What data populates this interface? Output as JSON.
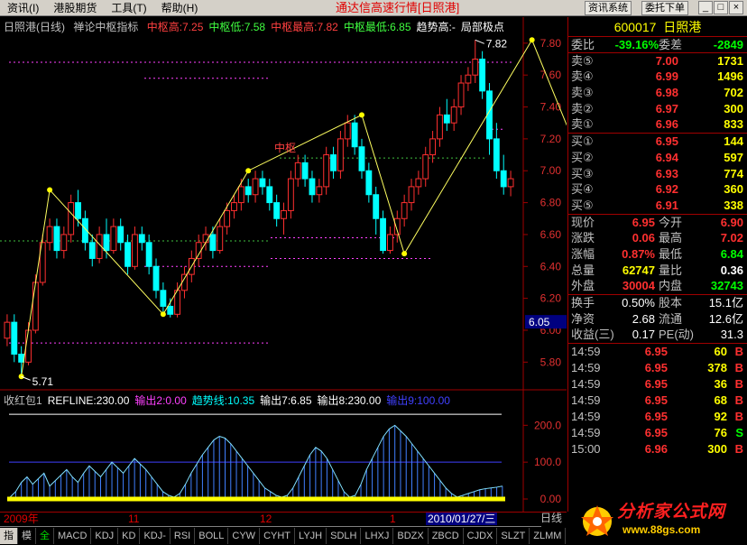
{
  "menu": {
    "items": [
      "资讯(I)",
      "港股期货",
      "工具(T)",
      "帮助(H)"
    ],
    "title": "通达信高速行情[日照港]",
    "btn_news": "资讯系统",
    "btn_entrust": "委托下单"
  },
  "main_legend": {
    "name": "日照港(日线)",
    "indicator": "禅论中枢指标",
    "items": [
      {
        "label": "中枢高:7.25",
        "color": "#ff4040"
      },
      {
        "label": "中枢低:7.58",
        "color": "#40ff40"
      },
      {
        "label": "中枢最高:7.82",
        "color": "#ff4040"
      },
      {
        "label": "中枢最低:6.85",
        "color": "#40ff40"
      },
      {
        "label": "趋势高:-",
        "color": "#ffffff"
      },
      {
        "label": "局部极点",
        "color": "#ffffff"
      }
    ]
  },
  "sub_legend": {
    "items": [
      {
        "label": "收红包1",
        "color": "#c0c0c0"
      },
      {
        "label": "REFLINE:230.00",
        "color": "#ffffff"
      },
      {
        "label": "输出2:0.00",
        "color": "#ff40ff"
      },
      {
        "label": "趋势线:10.35",
        "color": "#00ffff"
      },
      {
        "label": "输出7:6.85",
        "color": "#ffffff"
      },
      {
        "label": "输出8:230.00",
        "color": "#ffffff"
      },
      {
        "label": "输出9:100.00",
        "color": "#4040ff"
      }
    ]
  },
  "price_axis": {
    "ticks": [
      "7.80",
      "7.60",
      "7.40",
      "7.20",
      "7.00",
      "6.80",
      "6.60",
      "6.40",
      "6.20",
      "6.00",
      "5.80"
    ],
    "cursor": "6.05"
  },
  "sub_axis": {
    "ticks": [
      "200.0",
      "100.0",
      "0.00"
    ]
  },
  "annotations": {
    "high_label": "7.82",
    "low_label": "5.71",
    "zhong_shu_label": "中枢"
  },
  "dates": {
    "start": "2009年",
    "m11": "11",
    "m12": "12",
    "m1": "1",
    "cursor": "2010/01/27/三",
    "period": "日线"
  },
  "tabs": [
    "指标",
    "模板",
    "全部",
    "MACD",
    "KDJ",
    "KD",
    "KDJ-TDX",
    "RSI",
    "BOLL",
    "CYW",
    "CYHT",
    "LYJH",
    "SDLH",
    "LHXJ",
    "BDZX",
    "ZBCD",
    "CJDX",
    "SLZT",
    "ZLMM"
  ],
  "panel": {
    "code": "600017",
    "name": "日照港",
    "weibi_label": "委比",
    "weibi": "-39.16%",
    "weicha_label": "委差",
    "weicha": "-2849",
    "sell": [
      {
        "label": "卖⑤",
        "price": "7.00",
        "vol": "1731"
      },
      {
        "label": "卖④",
        "price": "6.99",
        "vol": "1496"
      },
      {
        "label": "卖③",
        "price": "6.98",
        "vol": "702"
      },
      {
        "label": "卖②",
        "price": "6.97",
        "vol": "300"
      },
      {
        "label": "卖①",
        "price": "6.96",
        "vol": "833"
      }
    ],
    "buy": [
      {
        "label": "买①",
        "price": "6.95",
        "vol": "144"
      },
      {
        "label": "买②",
        "price": "6.94",
        "vol": "597"
      },
      {
        "label": "买③",
        "price": "6.93",
        "vol": "774"
      },
      {
        "label": "买④",
        "price": "6.92",
        "vol": "360"
      },
      {
        "label": "买⑤",
        "price": "6.91",
        "vol": "338"
      }
    ],
    "stats": [
      {
        "l1": "现价",
        "v1": "6.95",
        "c1": "red",
        "l2": "今开",
        "v2": "6.90",
        "c2": "red"
      },
      {
        "l1": "涨跌",
        "v1": "0.06",
        "c1": "red",
        "l2": "最高",
        "v2": "7.02",
        "c2": "red"
      },
      {
        "l1": "涨幅",
        "v1": "0.87%",
        "c1": "red",
        "l2": "最低",
        "v2": "6.84",
        "c2": "green"
      },
      {
        "l1": "总量",
        "v1": "62747",
        "c1": "yellow",
        "l2": "量比",
        "v2": "0.36",
        "c2": "white"
      },
      {
        "l1": "外盘",
        "v1": "30004",
        "c1": "red",
        "l2": "内盘",
        "v2": "32743",
        "c2": "green"
      }
    ],
    "finance": [
      {
        "l1": "换手",
        "v1": "0.50%",
        "l2": "股本",
        "v2": "15.1亿"
      },
      {
        "l1": "净资",
        "v1": "2.68",
        "l2": "流通",
        "v2": "12.6亿"
      },
      {
        "l1": "收益(三)",
        "v1": "0.17",
        "l2": "PE(动)",
        "v2": "31.3"
      }
    ],
    "trades": [
      {
        "time": "14:59",
        "price": "6.95",
        "vol": "60",
        "dir": "B",
        "dcolor": "#ff3030"
      },
      {
        "time": "14:59",
        "price": "6.95",
        "vol": "378",
        "dir": "B",
        "dcolor": "#ff3030"
      },
      {
        "time": "14:59",
        "price": "6.95",
        "vol": "36",
        "dir": "B",
        "dcolor": "#ff3030"
      },
      {
        "time": "14:59",
        "price": "6.95",
        "vol": "68",
        "dir": "B",
        "dcolor": "#ff3030"
      },
      {
        "time": "14:59",
        "price": "6.95",
        "vol": "92",
        "dir": "B",
        "dcolor": "#ff3030"
      },
      {
        "time": "14:59",
        "price": "6.95",
        "vol": "76",
        "dir": "S",
        "dcolor": "#00ff00"
      },
      {
        "time": "15:00",
        "price": "6.96",
        "vol": "300",
        "dir": "B",
        "dcolor": "#ff3030"
      }
    ]
  },
  "watermark": {
    "text": "分析家公式网",
    "url": "www.88gs.com"
  },
  "chart_data": {
    "type": "candlestick",
    "ylim": [
      5.7,
      7.85
    ],
    "candles": [
      [
        5.95,
        6.05,
        6.1,
        5.9
      ],
      [
        6.05,
        5.85,
        6.1,
        5.8
      ],
      [
        5.85,
        5.8,
        5.9,
        5.71
      ],
      [
        5.8,
        6.0,
        6.05,
        5.78
      ],
      [
        6.0,
        6.3,
        6.35,
        5.98
      ],
      [
        6.3,
        6.55,
        6.6,
        6.28
      ],
      [
        6.55,
        6.65,
        6.7,
        6.5
      ],
      [
        6.65,
        6.5,
        6.7,
        6.45
      ],
      [
        6.5,
        6.6,
        6.65,
        6.45
      ],
      [
        6.6,
        6.8,
        6.85,
        6.55
      ],
      [
        6.8,
        6.7,
        6.88,
        6.65
      ],
      [
        6.7,
        6.55,
        6.75,
        6.5
      ],
      [
        6.55,
        6.45,
        6.6,
        6.4
      ],
      [
        6.45,
        6.6,
        6.65,
        6.42
      ],
      [
        6.6,
        6.5,
        6.7,
        6.45
      ],
      [
        6.5,
        6.65,
        6.7,
        6.48
      ],
      [
        6.65,
        6.55,
        6.7,
        6.5
      ],
      [
        6.55,
        6.4,
        6.6,
        6.35
      ],
      [
        6.4,
        6.6,
        6.65,
        6.38
      ],
      [
        6.6,
        6.55,
        6.65,
        6.5
      ],
      [
        6.55,
        6.4,
        6.6,
        6.35
      ],
      [
        6.4,
        6.25,
        6.45,
        6.2
      ],
      [
        6.25,
        6.15,
        6.3,
        6.1
      ],
      [
        6.15,
        6.1,
        6.2,
        6.08
      ],
      [
        6.1,
        6.25,
        6.3,
        6.08
      ],
      [
        6.25,
        6.35,
        6.4,
        6.2
      ],
      [
        6.35,
        6.45,
        6.5,
        6.3
      ],
      [
        6.45,
        6.55,
        6.6,
        6.4
      ],
      [
        6.55,
        6.6,
        6.65,
        6.5
      ],
      [
        6.6,
        6.5,
        6.65,
        6.45
      ],
      [
        6.5,
        6.65,
        6.7,
        6.48
      ],
      [
        6.65,
        6.75,
        6.8,
        6.6
      ],
      [
        6.75,
        6.8,
        6.85,
        6.7
      ],
      [
        6.8,
        6.9,
        6.95,
        6.75
      ],
      [
        6.9,
        6.85,
        6.95,
        6.8
      ],
      [
        6.85,
        6.95,
        7.0,
        6.8
      ],
      [
        6.95,
        6.9,
        7.0,
        6.85
      ],
      [
        6.9,
        6.8,
        6.95,
        6.75
      ],
      [
        6.8,
        6.7,
        6.85,
        6.65
      ],
      [
        6.7,
        6.75,
        6.8,
        6.6
      ],
      [
        6.75,
        6.95,
        7.0,
        6.7
      ],
      [
        6.95,
        7.05,
        7.1,
        6.9
      ],
      [
        7.05,
        6.95,
        7.1,
        6.9
      ],
      [
        6.95,
        6.85,
        7.0,
        6.8
      ],
      [
        6.85,
        6.9,
        6.95,
        6.8
      ],
      [
        6.9,
        7.1,
        7.15,
        6.85
      ],
      [
        7.1,
        7.0,
        7.15,
        6.95
      ],
      [
        7.0,
        7.2,
        7.25,
        6.95
      ],
      [
        7.2,
        7.3,
        7.35,
        7.15
      ],
      [
        7.3,
        7.15,
        7.35,
        7.1
      ],
      [
        7.15,
        7.0,
        7.2,
        6.95
      ],
      [
        7.0,
        6.85,
        7.05,
        6.8
      ],
      [
        6.85,
        6.7,
        6.9,
        6.6
      ],
      [
        6.7,
        6.5,
        6.75,
        6.48
      ],
      [
        6.5,
        6.6,
        6.65,
        6.48
      ],
      [
        6.6,
        6.7,
        6.75,
        6.55
      ],
      [
        6.7,
        6.8,
        6.85,
        6.65
      ],
      [
        6.8,
        6.9,
        6.95,
        6.75
      ],
      [
        6.9,
        6.95,
        7.0,
        6.85
      ],
      [
        6.95,
        7.1,
        7.15,
        6.9
      ],
      [
        7.1,
        7.2,
        7.25,
        7.05
      ],
      [
        7.2,
        7.35,
        7.4,
        7.15
      ],
      [
        7.35,
        7.3,
        7.45,
        7.25
      ],
      [
        7.3,
        7.4,
        7.45,
        7.25
      ],
      [
        7.4,
        7.55,
        7.6,
        7.35
      ],
      [
        7.55,
        7.6,
        7.65,
        7.5
      ],
      [
        7.6,
        7.7,
        7.82,
        7.55
      ],
      [
        7.7,
        7.5,
        7.75,
        7.45
      ],
      [
        7.5,
        7.2,
        7.55,
        7.1
      ],
      [
        7.2,
        7.0,
        7.3,
        6.95
      ],
      [
        7.0,
        6.9,
        7.1,
        6.85
      ],
      [
        6.9,
        6.95,
        7.0,
        6.84
      ]
    ],
    "zigzag": [
      [
        2,
        5.71
      ],
      [
        6,
        6.88
      ],
      [
        22,
        6.1
      ],
      [
        34,
        7.0
      ],
      [
        50,
        7.35
      ],
      [
        56,
        6.48
      ],
      [
        74,
        7.82
      ],
      [
        83,
        6.84
      ]
    ],
    "oscillator": [
      5,
      20,
      45,
      60,
      40,
      55,
      70,
      35,
      50,
      65,
      80,
      60,
      45,
      70,
      90,
      75,
      60,
      80,
      100,
      85,
      70,
      90,
      110,
      95,
      80,
      60,
      40,
      20,
      10,
      5,
      15,
      40,
      70,
      95,
      120,
      140,
      160,
      170,
      165,
      150,
      130,
      110,
      90,
      70,
      50,
      30,
      20,
      10,
      5,
      10,
      30,
      60,
      90,
      120,
      140,
      130,
      110,
      80,
      50,
      20,
      5,
      10,
      40,
      80,
      110,
      140,
      170,
      190,
      200,
      185,
      170,
      150,
      130,
      110,
      90,
      70,
      50,
      30,
      15,
      5,
      10,
      15,
      20,
      25,
      28,
      30,
      32,
      35
    ]
  }
}
